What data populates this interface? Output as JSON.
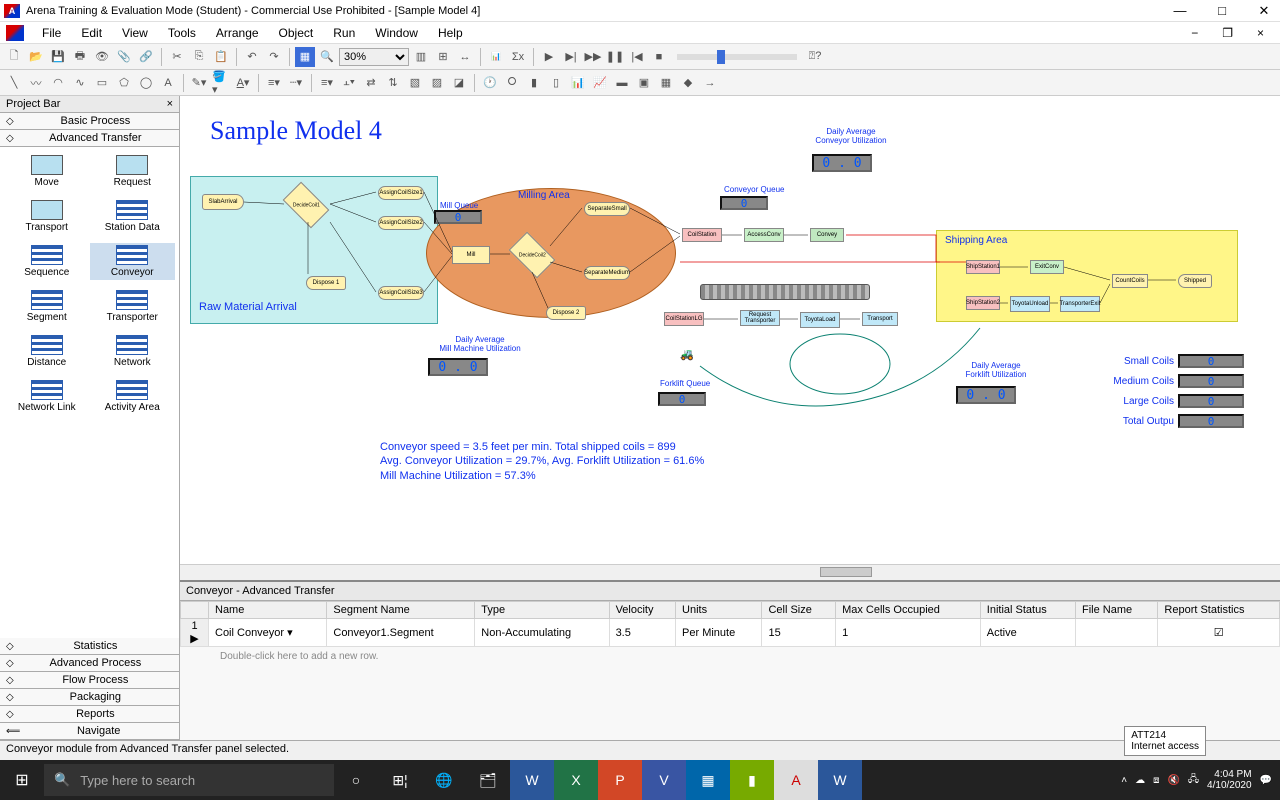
{
  "window": {
    "title": "Arena Training & Evaluation Mode (Student) - Commercial Use Prohibited - [Sample Model 4]"
  },
  "menus": [
    "File",
    "Edit",
    "View",
    "Tools",
    "Arrange",
    "Object",
    "Run",
    "Window",
    "Help"
  ],
  "zoom": "30%",
  "project_bar": {
    "title": "Project Bar",
    "sections_top": [
      "Basic Process",
      "Advanced Transfer"
    ],
    "items": [
      "Move",
      "Request",
      "Transport",
      "Station Data",
      "Sequence",
      "Conveyor",
      "Segment",
      "Transporter",
      "Distance",
      "Network",
      "Network Link",
      "Activity Area"
    ],
    "selected": "Conveyor",
    "sections_bottom": [
      "Statistics",
      "Advanced Process",
      "Flow Process",
      "Packaging",
      "Reports",
      "Navigate"
    ]
  },
  "model": {
    "title": "Sample Model 4",
    "raw_label": "Raw Material Arrival",
    "milling_label": "Milling Area",
    "shipping_label": "Shipping Area",
    "blocks": {
      "slab_arrival": "SlabArrival",
      "decide1": "DecideCoil1",
      "assign1": "AssignCoilSize1",
      "assign2": "AssignCoilSize2",
      "assign3": "AssignCoilSize3",
      "dispose1": "Dispose 1",
      "mill": "Mill",
      "decide2": "DecideCoil2",
      "sep_small": "SeparateSmall",
      "sep_med": "SeparateMedium",
      "dispose2": "Dispose 2",
      "coil_station": "CoilStation",
      "access_conv": "AccessConv",
      "convey": "Convey",
      "coil_station_lg": "CoilStationLG",
      "request_trans": "Request Transporter",
      "toyota_load": "ToyotaLoad",
      "transport": "Transport",
      "ship1": "ShipStation1",
      "exit_conv": "ExitConv",
      "count": "CountCoils",
      "shipped": "Shipped",
      "ship2": "ShipStation2",
      "toyota_unload": "ToyotaUnload",
      "trans_exit": "TransporterExit"
    },
    "counters": {
      "mill_queue_lbl": "Mill Queue",
      "mill_queue": "0",
      "conv_queue_lbl": "Conveyor Queue",
      "conv_queue": "0",
      "fork_queue_lbl": "Forklift Queue",
      "fork_queue": "0",
      "daily_conv_lbl": "Daily Average\nConveyor Utilization",
      "daily_conv": "0 . 0",
      "daily_mill_lbl": "Daily Average\nMill Machine Utilization",
      "daily_mill": "0 . 0",
      "daily_fork_lbl": "Daily Average\nForklift Utilization",
      "daily_fork": "0 . 0"
    },
    "outputs": {
      "small": "Small Coils",
      "small_v": "0",
      "med": "Medium Coils",
      "med_v": "0",
      "large": "Large Coils",
      "large_v": "0",
      "total": "Total Outpu",
      "total_v": "0"
    },
    "stats": "Conveyor speed = 3.5 feet per min. Total shipped coils = 899\nAvg. Conveyor Utilization = 29.7%, Avg. Forklift Utilization = 61.6%\nMill Machine Utilization = 57.3%"
  },
  "grid": {
    "title": "Conveyor - Advanced Transfer",
    "headers": [
      "",
      "Name",
      "Segment Name",
      "Type",
      "Velocity",
      "Units",
      "Cell Size",
      "Max Cells Occupied",
      "Initial Status",
      "File Name",
      "Report Statistics"
    ],
    "row": {
      "num": "1",
      "name": "Coil Conveyor",
      "segment": "Conveyor1.Segment",
      "type": "Non-Accumulating",
      "velocity": "3.5",
      "units": "Per Minute",
      "cell": "15",
      "max": "1",
      "status": "Active",
      "file": "",
      "report": "☑"
    },
    "hint": "Double-click here to add a new row."
  },
  "status": "Conveyor module from Advanced Transfer panel selected.",
  "tooltip": {
    "line1": "ATT214",
    "line2": "Internet access"
  },
  "taskbar": {
    "search_placeholder": "Type here to search",
    "time": "4:04 PM",
    "date": "4/10/2020"
  }
}
